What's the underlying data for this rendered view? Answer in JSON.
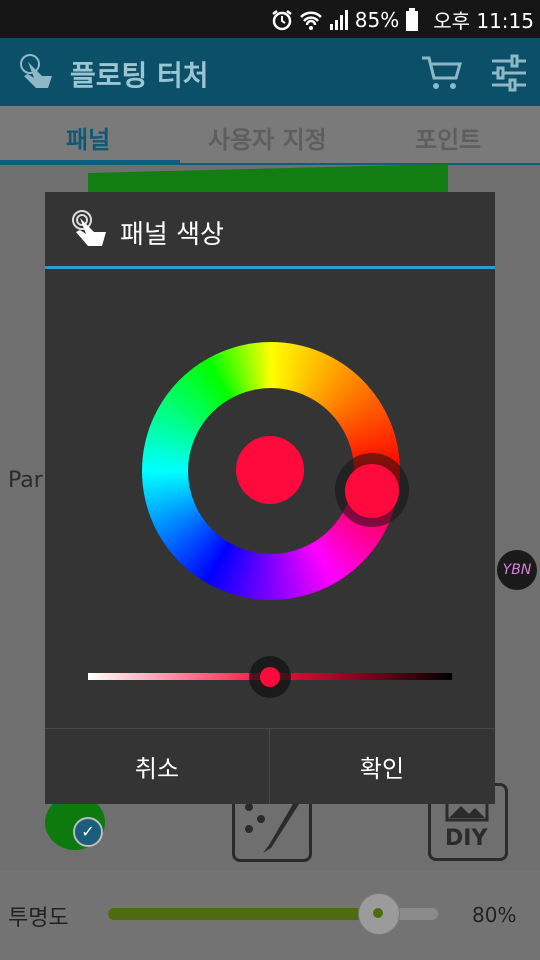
{
  "status_bar": {
    "battery": "85%",
    "time": "오후 11:15"
  },
  "app": {
    "title": "플로팅 터처"
  },
  "tabs": [
    {
      "label": "패널"
    },
    {
      "label": "사용자 지정"
    },
    {
      "label": "포인트"
    }
  ],
  "background": {
    "panel_text": "Par",
    "opacity_label": "투명도",
    "opacity_value": "80%",
    "opacity_fraction": 0.8,
    "diy_label": "DIY",
    "avatar_text": "YBN"
  },
  "dialog": {
    "title": "패널 색상",
    "cancel_label": "취소",
    "ok_label": "확인",
    "selected_color": "#ff0a3c",
    "brightness_fraction": 0.5,
    "accent_color": "#2a9bd4"
  },
  "icons": [
    "alarm-icon",
    "wifi-icon",
    "signal-icon",
    "battery-icon",
    "touch-hand-icon",
    "cart-icon",
    "settings-sliders-icon",
    "brush-icon",
    "image-icon",
    "check-icon"
  ]
}
